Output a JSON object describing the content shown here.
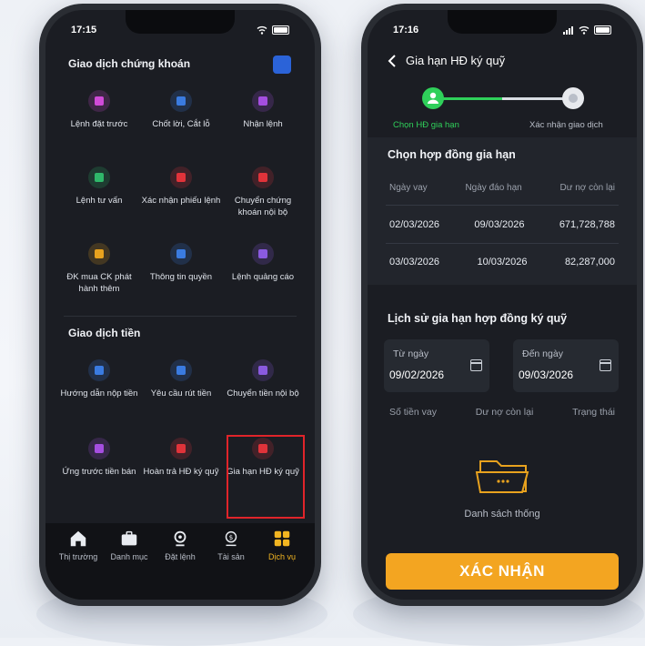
{
  "left_phone": {
    "status_time": "17:15",
    "section1_title": "Giao dịch chứng khoán",
    "section1_items": [
      {
        "label": "Lệnh đặt trước",
        "icon": "order-preset-icon",
        "color": "#d04bd8"
      },
      {
        "label": "Chốt lời, Cắt lỗ",
        "icon": "take-profit-icon",
        "color": "#3a7be0"
      },
      {
        "label": "Nhận lệnh",
        "icon": "cart-icon",
        "color": "#a54ee0"
      },
      {
        "label": "Lệnh tư vấn",
        "icon": "advisory-order-icon",
        "color": "#2fb86a"
      },
      {
        "label": "Xác nhận phiếu lệnh",
        "icon": "confirm-ticket-icon",
        "color": "#e0333a"
      },
      {
        "label": "Chuyển chứng khoán nội bộ",
        "icon": "transfer-stock-icon",
        "color": "#e0333a"
      },
      {
        "label": "ĐK mua CK phát hành thêm",
        "icon": "register-buy-icon",
        "color": "#e8a21e"
      },
      {
        "label": "Thông tin quyền",
        "icon": "rights-info-icon",
        "color": "#3a7be0"
      },
      {
        "label": "Lệnh quảng cáo",
        "icon": "advert-order-icon",
        "color": "#8a5ae0"
      }
    ],
    "section2_title": "Giao dịch tiền",
    "section2_items": [
      {
        "label": "Hướng dẫn nộp tiền",
        "icon": "deposit-guide-icon",
        "color": "#3a7be0"
      },
      {
        "label": "Yêu cầu rút tiền",
        "icon": "withdraw-icon",
        "color": "#3a7be0"
      },
      {
        "label": "Chuyển tiền nội bộ",
        "icon": "internal-transfer-icon",
        "color": "#8a5ae0"
      },
      {
        "label": "Ứng trước tiền bán",
        "icon": "advance-sale-icon",
        "color": "#a54ee0"
      },
      {
        "label": "Hoàn trả HĐ ký quỹ",
        "icon": "repay-margin-icon",
        "color": "#e0333a"
      },
      {
        "label": "Gia hạn HĐ ký quỹ",
        "icon": "extend-margin-icon",
        "color": "#e0333a"
      }
    ],
    "tabs": [
      {
        "label": "Thị trường",
        "icon": "home-icon"
      },
      {
        "label": "Danh mục",
        "icon": "briefcase-icon"
      },
      {
        "label": "Đặt lệnh",
        "icon": "order-icon"
      },
      {
        "label": "Tài sản",
        "icon": "asset-icon"
      },
      {
        "label": "Dịch vụ",
        "icon": "services-icon"
      }
    ],
    "active_tab": "Dịch vụ",
    "highlight_color": "#e0242a",
    "accent_color": "#f2b521"
  },
  "right_phone": {
    "status_time": "17:16",
    "title": "Gia hạn HĐ ký quỹ",
    "steps": [
      "Chọn HĐ gia hạn",
      "Xác nhận giao dịch"
    ],
    "contracts_title": "Chọn hợp đồng gia hạn",
    "contracts_headers": [
      "Ngày vay",
      "Ngày đáo hạn",
      "Dư nợ còn lại"
    ],
    "contracts": [
      [
        "02/03/2026",
        "09/03/2026",
        "671,728,788"
      ],
      [
        "03/03/2026",
        "10/03/2026",
        "82,287,000"
      ]
    ],
    "history_title": "Lịch sử gia hạn hợp đồng ký quỹ",
    "from_label": "Từ ngày",
    "from_value": "09/02/2026",
    "to_label": "Đến ngày",
    "to_value": "09/03/2026",
    "history_headers": [
      "Số tiền vay",
      "Dư nợ còn lại",
      "Trạng thái"
    ],
    "empty_text": "Danh sách thống",
    "confirm_label": "XÁC NHẬN",
    "confirm_color": "#f3a521",
    "step_active_color": "#2fd05a"
  }
}
